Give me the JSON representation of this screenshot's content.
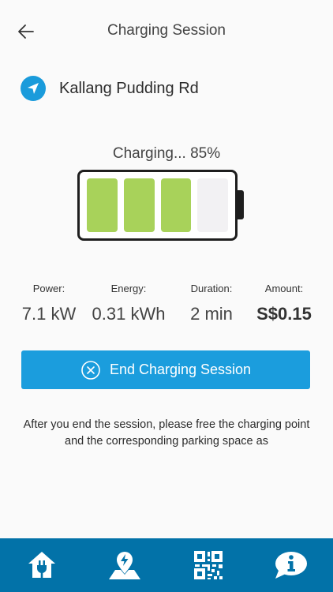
{
  "header": {
    "title": "Charging Session"
  },
  "location": {
    "name": "Kallang Pudding Rd"
  },
  "charging": {
    "status": "Charging... 85%",
    "level": 0.85,
    "cells_filled": 3,
    "cells_total": 4
  },
  "stats": [
    {
      "label": "Power:",
      "value": "7.1 kW"
    },
    {
      "label": "Energy:",
      "value": "0.31 kWh"
    },
    {
      "label": "Duration:",
      "value": "2 min"
    },
    {
      "label": "Amount:",
      "value": "S$0.15"
    }
  ],
  "end_button": {
    "label": "End Charging Session"
  },
  "note": "After you end the session, please free the charging point and the corresponding parking space as",
  "nav": {
    "items": [
      {
        "icon": "home-plug-icon"
      },
      {
        "icon": "map-pin-icon"
      },
      {
        "icon": "qr-code-icon"
      },
      {
        "icon": "info-bubble-icon"
      }
    ]
  },
  "colors": {
    "accent": "#1b9ddd",
    "nav_bg": "#0272a8",
    "battery_fill": "#a8d25a",
    "battery_empty": "#f2f1f3"
  }
}
